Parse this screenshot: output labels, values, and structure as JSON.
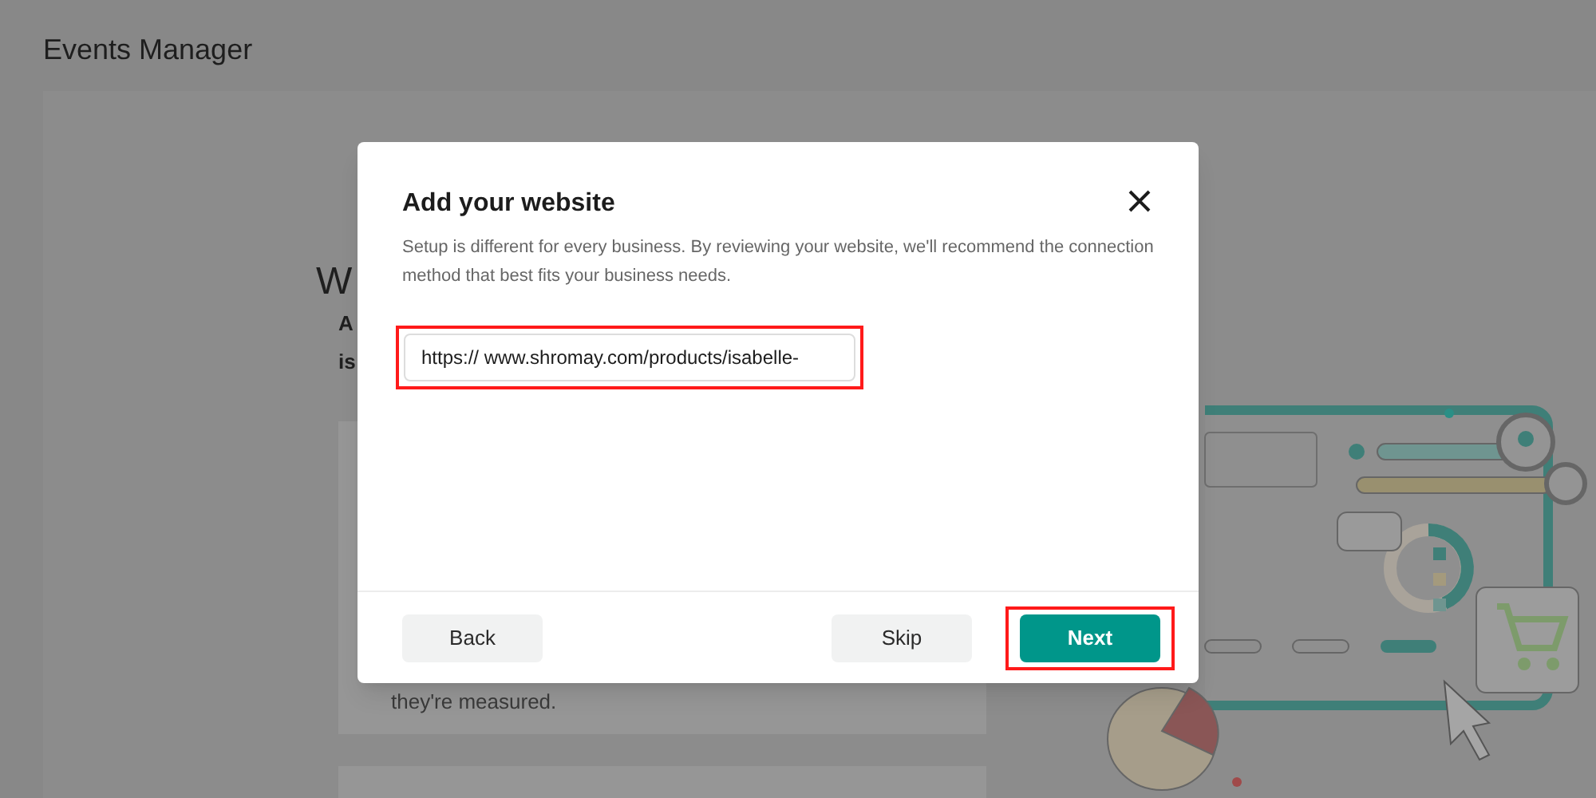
{
  "page": {
    "title": "Events Manager"
  },
  "background": {
    "heading": "W",
    "intro_lines": [
      "A",
      "is"
    ],
    "card_text": "they're measured."
  },
  "dialog": {
    "title": "Add your website",
    "description": "Setup is different for every business. By reviewing your website, we'll recommend the connection method that best fits your business needs.",
    "url_field": {
      "value": "https:// www.shromay.com/products/isabelle-",
      "highlighted": true
    },
    "buttons": [
      {
        "label": "Back",
        "kind": "secondary",
        "highlighted": false
      },
      {
        "label": "Skip",
        "kind": "secondary",
        "highlighted": false
      },
      {
        "label": "Next",
        "kind": "primary",
        "highlighted": true
      }
    ]
  }
}
